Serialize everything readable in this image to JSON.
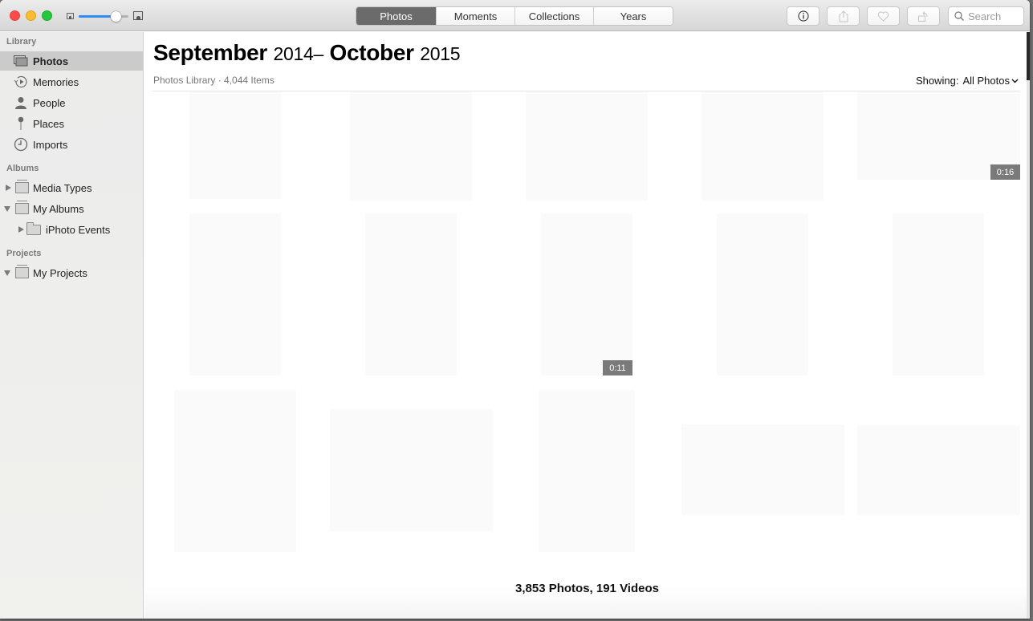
{
  "toolbar": {
    "window_controls": [
      "close",
      "minimize",
      "maximize"
    ],
    "thumbnail_size_slider": {
      "value": 0.75,
      "accent": "#2f8cf7"
    },
    "view_tabs": [
      {
        "label": "Photos",
        "active": true
      },
      {
        "label": "Moments",
        "active": false
      },
      {
        "label": "Collections",
        "active": false
      },
      {
        "label": "Years",
        "active": false
      }
    ],
    "buttons": [
      {
        "icon": "info-icon",
        "glyph": "ⓘ",
        "enabled": true
      },
      {
        "icon": "share-icon",
        "glyph": "⇪",
        "enabled": false
      },
      {
        "icon": "heart-icon",
        "glyph": "♡",
        "enabled": false
      },
      {
        "icon": "rotate-icon",
        "glyph": "⟲",
        "enabled": false
      }
    ],
    "search": {
      "placeholder": "Search"
    }
  },
  "sidebar": {
    "sections": {
      "library": "Library",
      "albums": "Albums",
      "projects": "Projects"
    },
    "library_items": [
      {
        "label": "Photos",
        "icon": "photos-icon",
        "selected": true
      },
      {
        "label": "Memories",
        "icon": "memories-icon",
        "selected": false
      },
      {
        "label": "People",
        "icon": "people-icon",
        "selected": false
      },
      {
        "label": "Places",
        "icon": "places-pin-icon",
        "selected": false
      },
      {
        "label": "Imports",
        "icon": "imports-clock-icon",
        "selected": false
      }
    ],
    "album_items": [
      {
        "label": "Media Types",
        "icon": "album-stack-icon",
        "expanded": false
      },
      {
        "label": "My Albums",
        "icon": "album-stack-icon",
        "expanded": true
      },
      {
        "label": "iPhoto Events",
        "icon": "folder-icon",
        "expanded": false
      }
    ],
    "project_items": [
      {
        "label": "My Projects",
        "icon": "album-stack-icon",
        "expanded": true
      }
    ]
  },
  "main": {
    "title": {
      "start_month": "September",
      "start_year": "2014",
      "separator": "–",
      "end_month": "October",
      "end_year": "2015"
    },
    "subtitle": "Photos Library · 4,044 Items",
    "showing": {
      "label": "Showing:",
      "value": "All Photos"
    },
    "tiles": [
      {
        "kind": "photo"
      },
      {
        "kind": "photo"
      },
      {
        "kind": "photo"
      },
      {
        "kind": "photo"
      },
      {
        "kind": "video",
        "duration": "0:16"
      },
      {
        "kind": "photo"
      },
      {
        "kind": "photo"
      },
      {
        "kind": "video",
        "duration": "0:11"
      },
      {
        "kind": "photo"
      },
      {
        "kind": "photo"
      },
      {
        "kind": "photo"
      },
      {
        "kind": "photo"
      },
      {
        "kind": "photo"
      },
      {
        "kind": "photo"
      },
      {
        "kind": "photo"
      }
    ],
    "footer_count": "3,853 Photos, 191 Videos"
  }
}
